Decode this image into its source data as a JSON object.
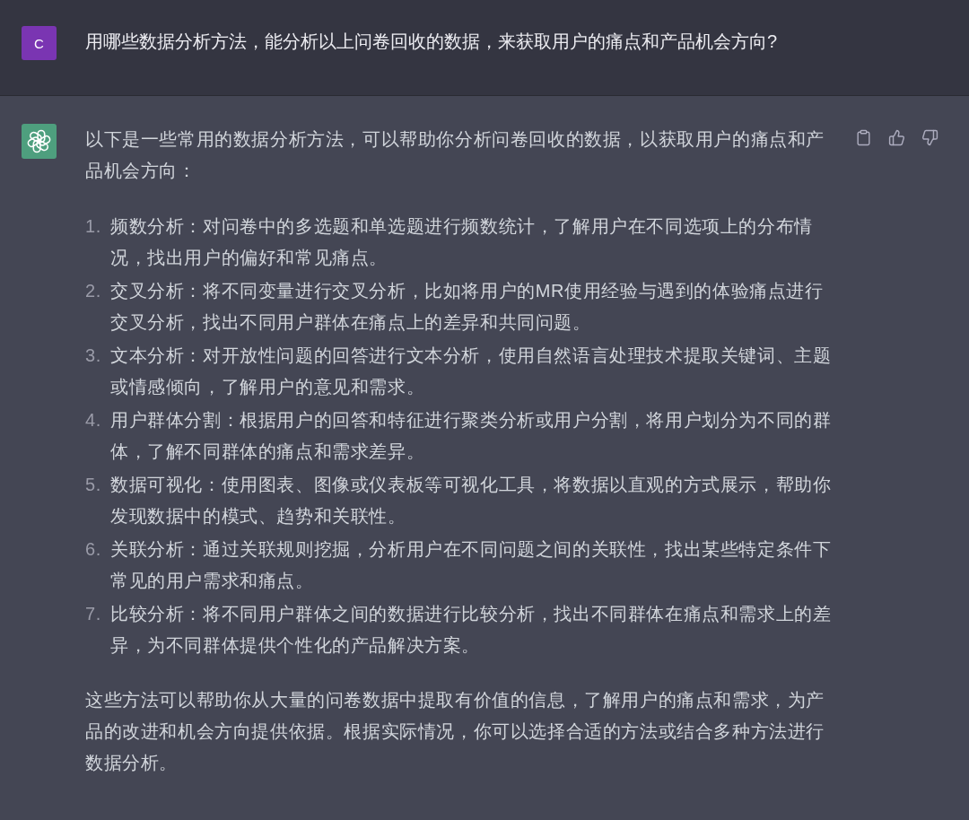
{
  "user_message": {
    "avatar_letter": "C",
    "text": "用哪些数据分析方法，能分析以上问卷回收的数据，来获取用户的痛点和产品机会方向?"
  },
  "assistant_message": {
    "intro": "以下是一些常用的数据分析方法，可以帮助你分析问卷回收的数据，以获取用户的痛点和产品机会方向：",
    "items": [
      {
        "number": "1.",
        "text": "频数分析：对问卷中的多选题和单选题进行频数统计，了解用户在不同选项上的分布情况，找出用户的偏好和常见痛点。"
      },
      {
        "number": "2.",
        "text": "交叉分析：将不同变量进行交叉分析，比如将用户的MR使用经验与遇到的体验痛点进行交叉分析，找出不同用户群体在痛点上的差异和共同问题。"
      },
      {
        "number": "3.",
        "text": "文本分析：对开放性问题的回答进行文本分析，使用自然语言处理技术提取关键词、主题或情感倾向，了解用户的意见和需求。"
      },
      {
        "number": "4.",
        "text": "用户群体分割：根据用户的回答和特征进行聚类分析或用户分割，将用户划分为不同的群体，了解不同群体的痛点和需求差异。"
      },
      {
        "number": "5.",
        "text": "数据可视化：使用图表、图像或仪表板等可视化工具，将数据以直观的方式展示，帮助你发现数据中的模式、趋势和关联性。"
      },
      {
        "number": "6.",
        "text": "关联分析：通过关联规则挖掘，分析用户在不同问题之间的关联性，找出某些特定条件下常见的用户需求和痛点。"
      },
      {
        "number": "7.",
        "text": "比较分析：将不同用户群体之间的数据进行比较分析，找出不同群体在痛点和需求上的差异，为不同群体提供个性化的产品解决方案。"
      }
    ],
    "conclusion": "这些方法可以帮助你从大量的问卷数据中提取有价值的信息，了解用户的痛点和需求，为产品的改进和机会方向提供依据。根据实际情况，你可以选择合适的方法或结合多种方法进行数据分析。"
  }
}
